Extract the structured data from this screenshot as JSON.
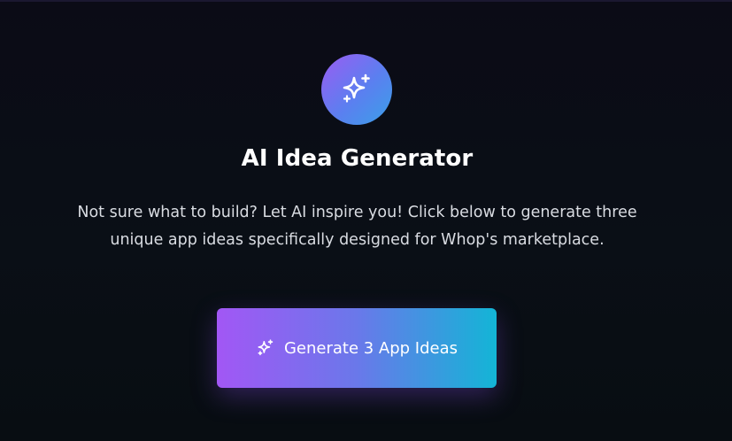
{
  "hero": {
    "icon": "sparkles-icon",
    "title": "AI Idea Generator",
    "description": "Not sure what to build? Let AI inspire you! Click below to generate three unique app ideas specifically designed for Whop's marketplace."
  },
  "action": {
    "icon": "sparkles-icon",
    "label": "Generate 3 App Ideas"
  },
  "colors": {
    "background": "#0a0f16",
    "accent_start": "#a257f5",
    "accent_end": "#13b5d6"
  }
}
